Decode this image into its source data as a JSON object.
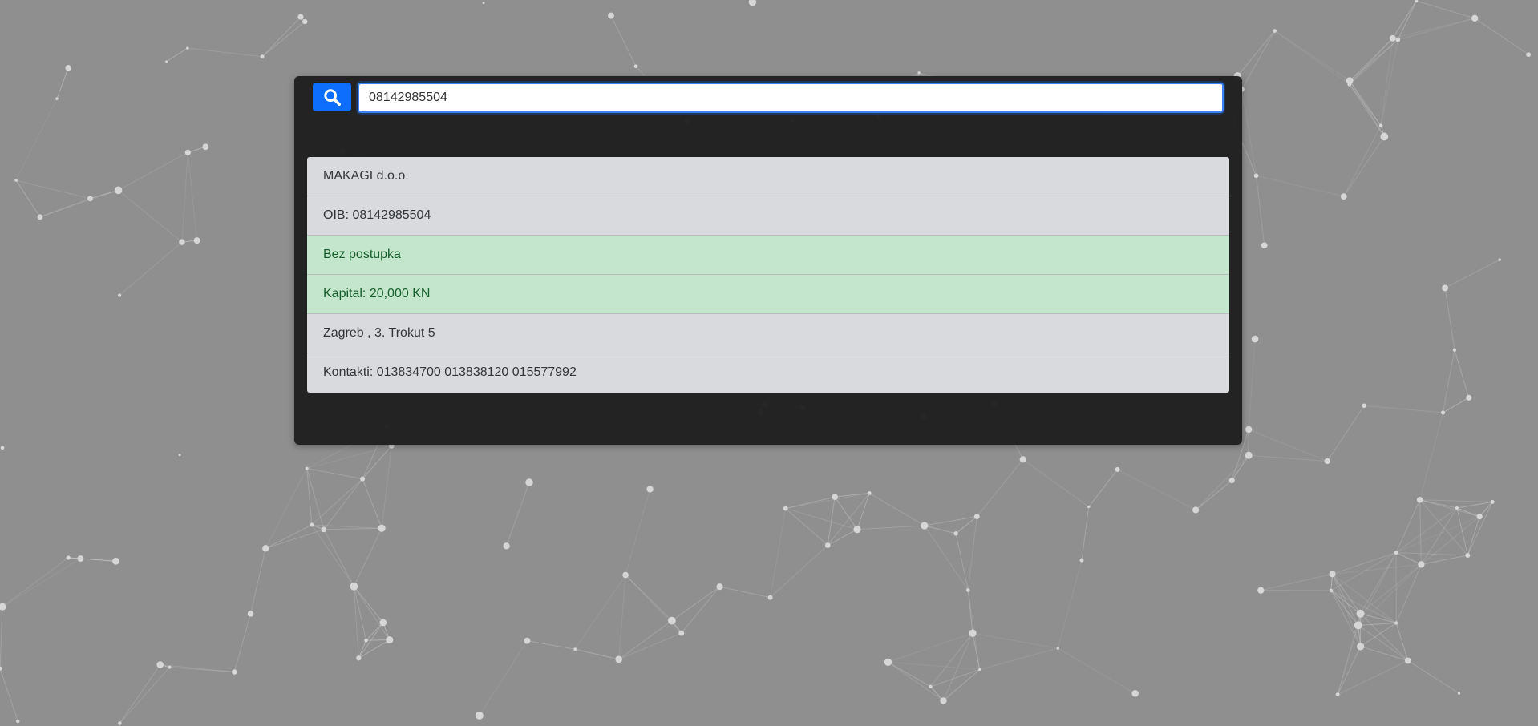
{
  "search": {
    "value": "08142985504",
    "icon": "search-icon",
    "button_color": "#0d6efd"
  },
  "results": [
    {
      "text": "MAKAGI d.o.o.",
      "status": "default"
    },
    {
      "text": "OIB: 08142985504",
      "status": "default"
    },
    {
      "text": "Bez postupka",
      "status": "success"
    },
    {
      "text": "Kapital: 20,000 KN",
      "status": "success"
    },
    {
      "text": "Zagreb , 3. Trokut 5",
      "status": "default"
    },
    {
      "text": "Kontakti: 013834700 013838120 015577992",
      "status": "default"
    }
  ],
  "colors": {
    "background": "#8f8f8f",
    "panel": "#1e1e1e",
    "row_default": "#d9dadd",
    "row_success": "#c4e6cc"
  }
}
